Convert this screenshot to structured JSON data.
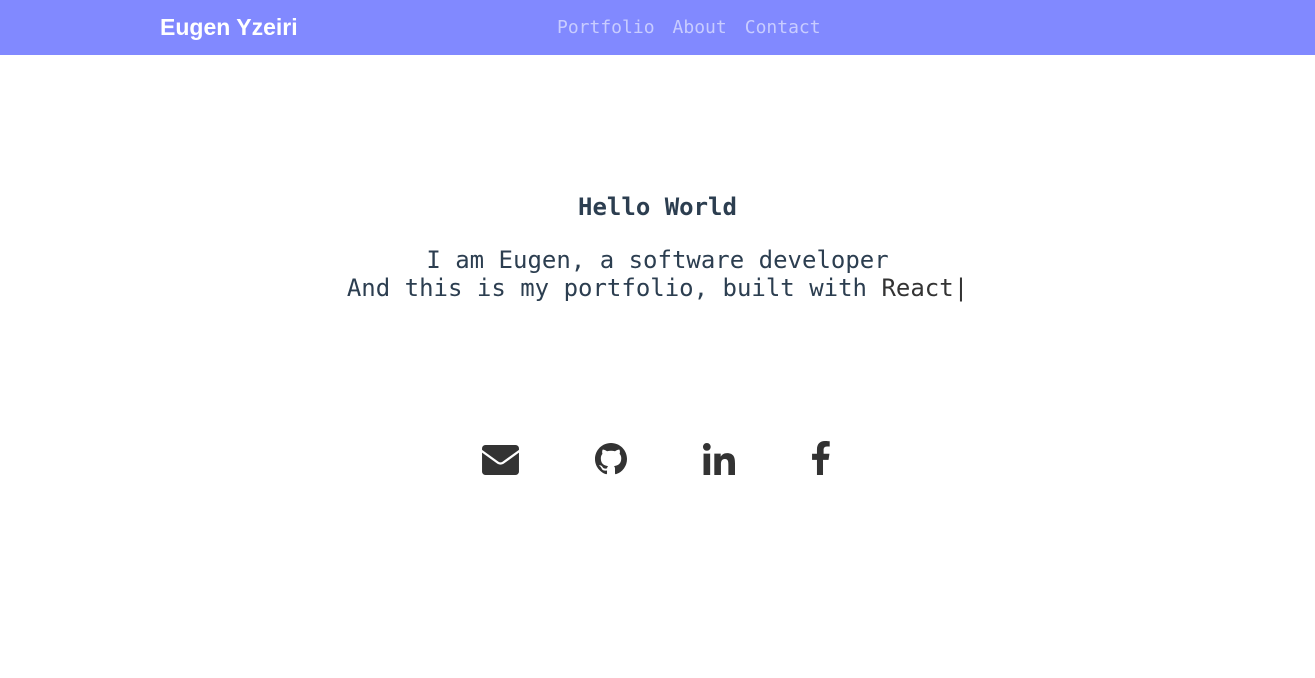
{
  "navbar": {
    "brand": "Eugen Yzeiri",
    "links": [
      "Portfolio",
      "About",
      "Contact"
    ]
  },
  "hero": {
    "title": "Hello World",
    "line1": "I am Eugen, a software developer",
    "line2_prefix": "And this is my portfolio, built with ",
    "line2_tech": "React",
    "cursor": "|"
  },
  "social": {
    "icons": [
      "envelope-icon",
      "github-icon",
      "linkedin-icon",
      "facebook-icon"
    ]
  },
  "colors": {
    "navbar_bg": "#8189ff",
    "brand_text": "#ffffff",
    "nav_link": "#c8ccff",
    "heading_text": "#2c3e50",
    "icon": "#333333"
  }
}
